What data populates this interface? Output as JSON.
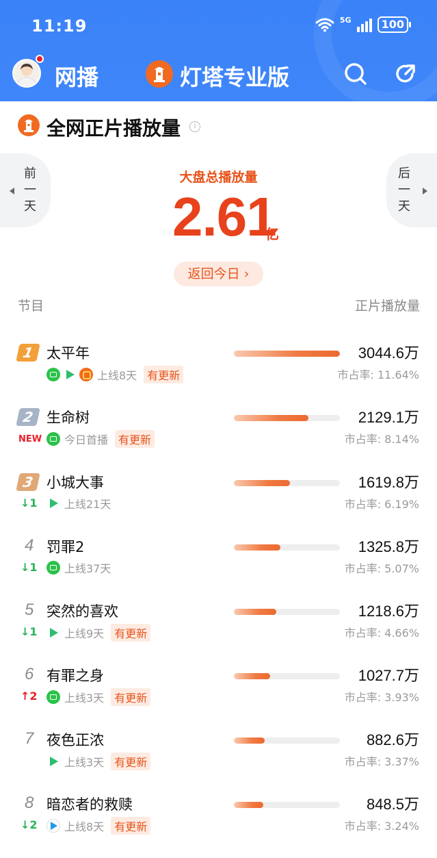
{
  "status_bar": {
    "time": "11:19",
    "network": "5G",
    "battery": "100"
  },
  "header": {
    "left_title": "网播",
    "center_title": "灯塔专业版"
  },
  "section": {
    "title": "全网正片播放量",
    "prev_day": [
      "前",
      "一",
      "天"
    ],
    "next_day": [
      "后",
      "一",
      "天"
    ],
    "total_label": "大盘总播放量",
    "total_value": "2.61",
    "total_unit": "亿",
    "back_today": "返回今日 ›"
  },
  "columns": {
    "program": "节目",
    "plays": "正片播放量"
  },
  "colors": {
    "accent": "#e8421c",
    "header_blue": "#3a82f7",
    "gold": "#f2a03a",
    "silver": "#a7b3c6",
    "bronze": "#e0a877",
    "up": "#e8202a",
    "down": "#2bb35a"
  },
  "rows": [
    {
      "rank": "1",
      "title": "太平年",
      "change": "",
      "change_dir": "",
      "platforms": [
        "iqiyi",
        "tencent",
        "mango"
      ],
      "status": "上线8天",
      "update": "有更新",
      "value": "3044.6万",
      "share": "市占率: 11.64%",
      "share_pct": 11.64
    },
    {
      "rank": "2",
      "title": "生命树",
      "change": "NEW",
      "change_dir": "new",
      "platforms": [
        "iqiyi"
      ],
      "status": "今日首播",
      "update": "有更新",
      "value": "2129.1万",
      "share": "市占率: 8.14%",
      "share_pct": 8.14
    },
    {
      "rank": "3",
      "title": "小城大事",
      "change": "↓1",
      "change_dir": "down",
      "platforms": [
        "tencent"
      ],
      "status": "上线21天",
      "update": "",
      "value": "1619.8万",
      "share": "市占率: 6.19%",
      "share_pct": 6.19
    },
    {
      "rank": "4",
      "title": "罚罪2",
      "change": "↓1",
      "change_dir": "down",
      "platforms": [
        "iqiyi"
      ],
      "status": "上线37天",
      "update": "",
      "value": "1325.8万",
      "share": "市占率: 5.07%",
      "share_pct": 5.07
    },
    {
      "rank": "5",
      "title": "突然的喜欢",
      "change": "↓1",
      "change_dir": "down",
      "platforms": [
        "tencent"
      ],
      "status": "上线9天",
      "update": "有更新",
      "value": "1218.6万",
      "share": "市占率: 4.66%",
      "share_pct": 4.66
    },
    {
      "rank": "6",
      "title": "有罪之身",
      "change": "↑2",
      "change_dir": "up",
      "platforms": [
        "iqiyi"
      ],
      "status": "上线3天",
      "update": "有更新",
      "value": "1027.7万",
      "share": "市占率: 3.93%",
      "share_pct": 3.93
    },
    {
      "rank": "7",
      "title": "夜色正浓",
      "change": "",
      "change_dir": "",
      "platforms": [
        "tencent"
      ],
      "status": "上线3天",
      "update": "有更新",
      "value": "882.6万",
      "share": "市占率: 3.37%",
      "share_pct": 3.37
    },
    {
      "rank": "8",
      "title": "暗恋者的救赎",
      "change": "↓2",
      "change_dir": "down",
      "platforms": [
        "youku"
      ],
      "status": "上线8天",
      "update": "有更新",
      "value": "848.5万",
      "share": "市占率: 3.24%",
      "share_pct": 3.24
    }
  ]
}
